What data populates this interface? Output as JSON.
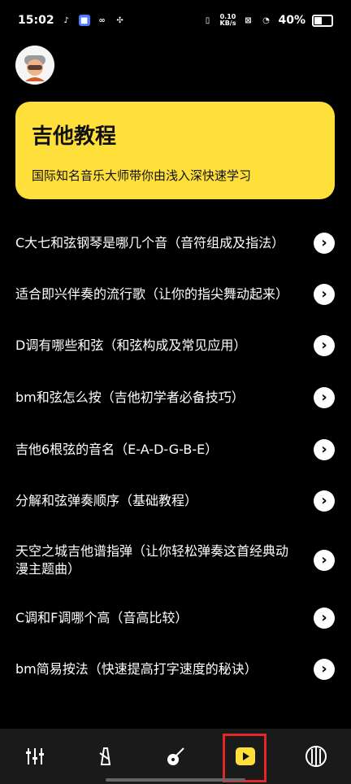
{
  "status": {
    "time": "15:02",
    "speed_value": "0.10",
    "speed_unit": "KB/s",
    "battery": "40%"
  },
  "hero": {
    "title": "吉他教程",
    "subtitle": "国际知名音乐大师带你由浅入深快速学习"
  },
  "list": [
    "C大七和弦钢琴是哪几个音（音符组成及指法）",
    "适合即兴伴奏的流行歌（让你的指尖舞动起来）",
    "D调有哪些和弦（和弦构成及常见应用）",
    "bm和弦怎么按（吉他初学者必备技巧）",
    "吉他6根弦的音名（E-A-D-G-B-E）",
    "分解和弦弹奏顺序（基础教程）",
    "天空之城吉他谱指弹（让你轻松弹奏这首经典动漫主题曲）",
    "C调和F调哪个高（音高比较）",
    "bm简易按法（快速提高打字速度的秘诀）"
  ],
  "chevron_glyph": "›",
  "nav": [
    {
      "icon": "mixer-sliders-icon"
    },
    {
      "icon": "metronome-icon"
    },
    {
      "icon": "guitar-icon"
    },
    {
      "icon": "play-icon",
      "selected": true
    },
    {
      "icon": "strings-icon"
    }
  ],
  "colors": {
    "accent": "#ffdf3a",
    "background": "#000000",
    "nav_bg": "#1a1a1a",
    "highlight": "#e32626"
  }
}
